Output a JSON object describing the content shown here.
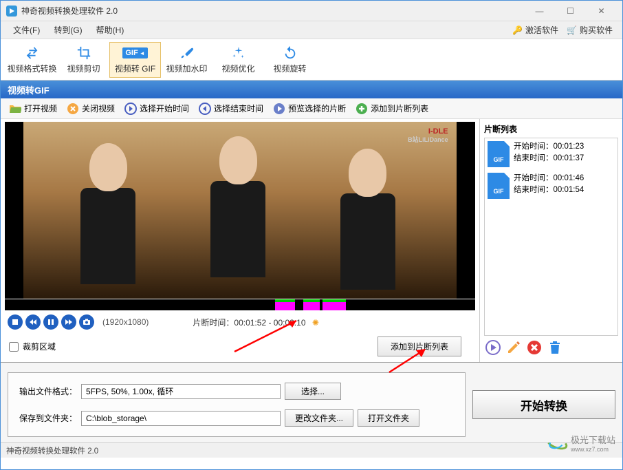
{
  "titlebar": {
    "title": "神奇视频转换处理软件 2.0"
  },
  "menubar": {
    "file": "文件(F)",
    "goto": "转到(G)",
    "help": "帮助(H)",
    "activate": "激活软件",
    "buy": "购买软件"
  },
  "toolbar": {
    "format": "视频格式转换",
    "cut": "视频剪切",
    "gif": "视频转 GIF",
    "watermark": "视频加水印",
    "optimize": "视频优化",
    "rotate": "视频旋转"
  },
  "section": {
    "title": "视频转GIF"
  },
  "actions": {
    "open": "打开视频",
    "close": "关闭视频",
    "selstart": "选择开始时间",
    "selend": "选择结束时间",
    "preview": "预览选择的片断",
    "addclip": "添加到片断列表"
  },
  "video": {
    "watermark1": "I-DLE",
    "watermark2": "B站LiLiDance",
    "resolution": "(1920x1080)",
    "clip_label": "片断时间：",
    "clip_range": "00:01:52 - 00:02:10",
    "crop_label": "裁剪区域",
    "add_button": "添加到片断列表"
  },
  "side": {
    "title": "片断列表",
    "items": [
      {
        "start_label": "开始时间：",
        "start": "00:01:23",
        "end_label": "结束时间：",
        "end": "00:01:37"
      },
      {
        "start_label": "开始时间：",
        "start": "00:01:46",
        "end_label": "结束时间：",
        "end": "00:01:54"
      }
    ]
  },
  "settings": {
    "format_label": "输出文件格式：",
    "format_value": "5FPS, 50%, 1.00x, 循环",
    "select_btn": "选择...",
    "folder_label": "保存到文件夹：",
    "folder_value": "C:\\blob_storage\\",
    "change_btn": "更改文件夹...",
    "open_btn": "打开文件夹"
  },
  "convert": {
    "button": "开始转换"
  },
  "statusbar": {
    "text": "神奇视频转换处理软件 2.0"
  },
  "footer": {
    "brand": "极光下载站",
    "url": "www.xz7.com"
  }
}
